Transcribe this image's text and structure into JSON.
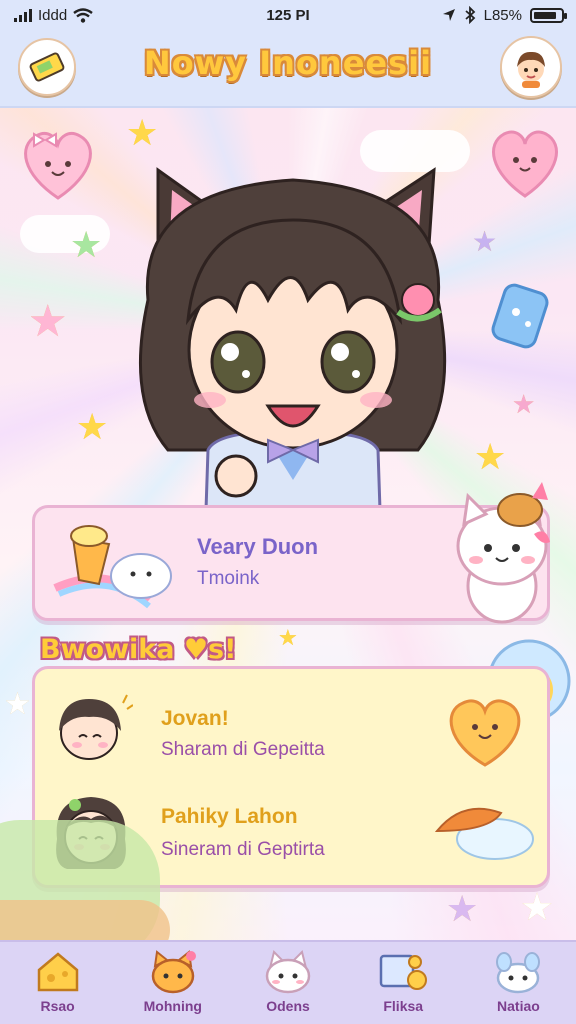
{
  "status_bar": {
    "carrier": "Iddd",
    "time": "125 PI",
    "battery_text": "L85%",
    "battery_level": 0.85
  },
  "header": {
    "title": "Nowy Inoneesii",
    "left_icon": "ticket-icon",
    "right_icon": "avatar-icon"
  },
  "hero": {
    "character_icon": "chibi-cat-girl-illustration"
  },
  "profile_card": {
    "name": "Veary Duon",
    "subtitle": "Tmoink"
  },
  "friends_section": {
    "title": "Bwowika ♥s!",
    "items": [
      {
        "name": "Jovan!",
        "subtitle": "Sharam di Gepeitta"
      },
      {
        "name": "Pahiky Lahon",
        "subtitle": "Sineram di Geptirta"
      }
    ]
  },
  "tab_bar": {
    "tabs": [
      {
        "label": "Rsao",
        "icon": "cheese-house-icon"
      },
      {
        "label": "Mohning",
        "icon": "cat-face-icon"
      },
      {
        "label": "Odens",
        "icon": "kitty-icon"
      },
      {
        "label": "Fliksa",
        "icon": "screen-cookie-icon"
      },
      {
        "label": "Natiao",
        "icon": "bunny-icon"
      }
    ]
  },
  "colors": {
    "accent_yellow": "#ffc83d",
    "accent_purple": "#7a64c9",
    "accent_pink": "#e9b3d3",
    "header_bg": "#dde6fb",
    "tabbar_bg": "#dcd4f5"
  }
}
